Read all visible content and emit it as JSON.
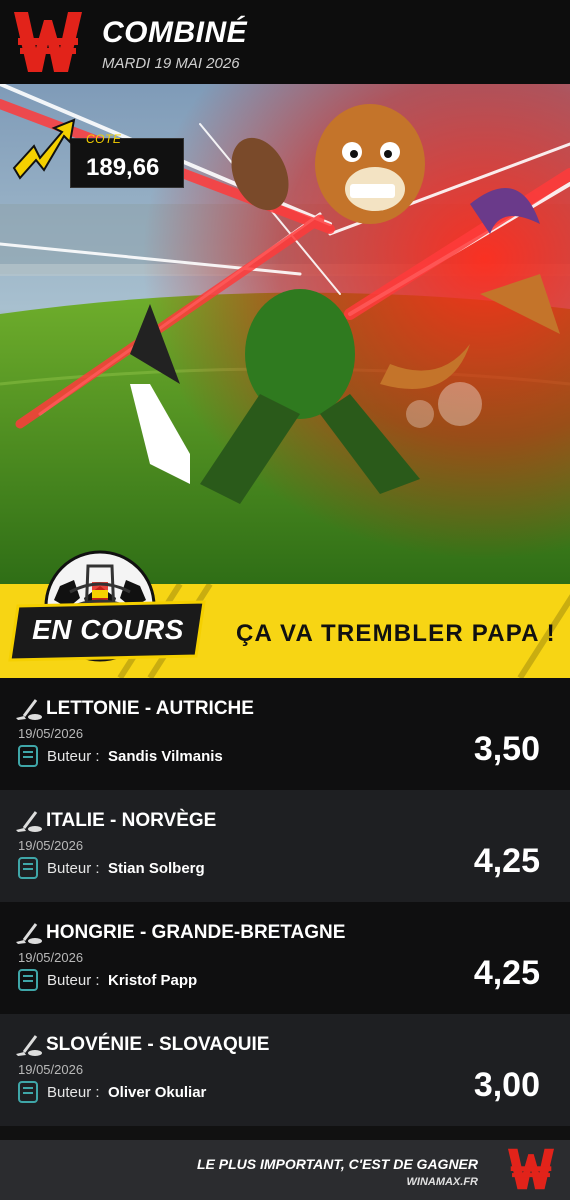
{
  "header": {
    "title": "COMBINÉ",
    "date": "MARDI 19 MAI 2026"
  },
  "cote": {
    "label": "COTE",
    "value": "189,66"
  },
  "banner": {
    "status": "EN COURS",
    "tagline": "ÇA VA TREMBLER PAPA !"
  },
  "bets": [
    {
      "match": "LETTONIE - AUTRICHE",
      "date": "19/05/2026",
      "label": "Buteur :",
      "player": "Sandis Vilmanis",
      "odds": "3,50"
    },
    {
      "match": "ITALIE - NORVÈGE",
      "date": "19/05/2026",
      "label": "Buteur :",
      "player": "Stian Solberg",
      "odds": "4,25"
    },
    {
      "match": "HONGRIE - GRANDE-BRETAGNE",
      "date": "19/05/2026",
      "label": "Buteur :",
      "player": "Kristof Papp",
      "odds": "4,25"
    },
    {
      "match": "SLOVÉNIE - SLOVAQUIE",
      "date": "19/05/2026",
      "label": "Buteur :",
      "player": "Oliver Okuliar",
      "odds": "3,00"
    }
  ],
  "footer": {
    "slogan": "LE PLUS IMPORTANT, C'EST DE GAGNER",
    "site": "WINAMAX.FR"
  },
  "colors": {
    "brand_red": "#e2231a",
    "accent_yellow": "#f7d514"
  },
  "icons": [
    "winamax-logo-icon",
    "cote-arrow-icon",
    "soccer-ball-icon",
    "hockey-stick-icon",
    "bet-type-icon"
  ]
}
